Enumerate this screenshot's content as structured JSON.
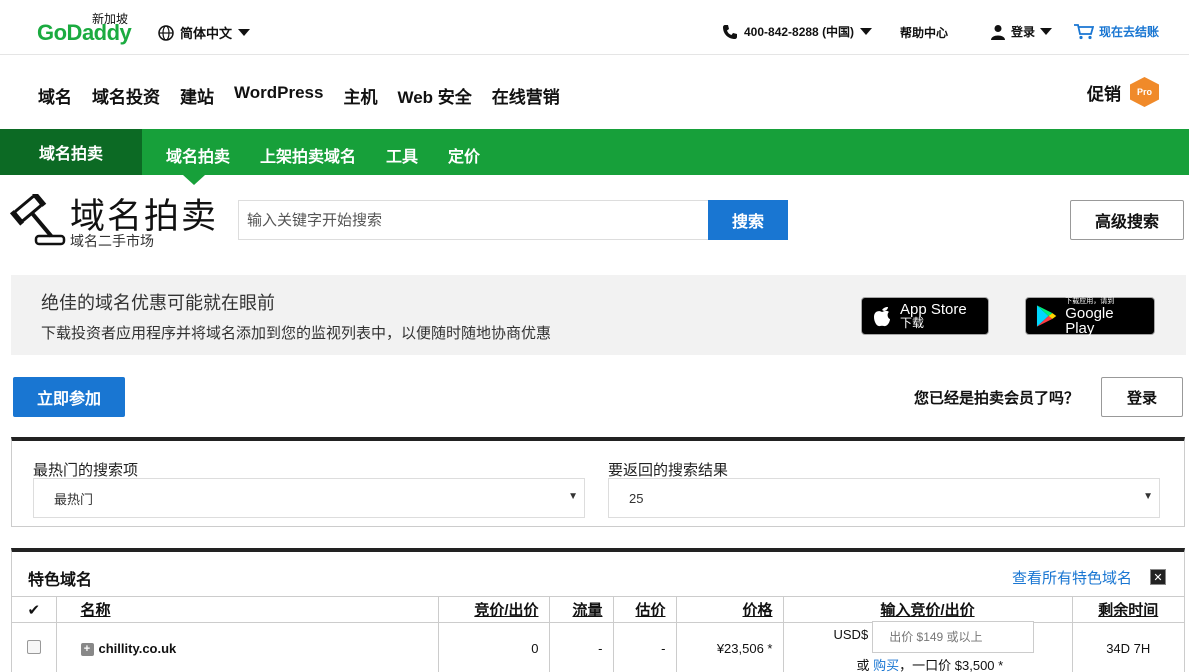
{
  "topbar": {
    "logo_sub": "新加坡",
    "logo_main": "GoDaddy",
    "language": "简体中文",
    "phone": "400-842-8288 (中国)",
    "help": "帮助中心",
    "login": "登录",
    "cart": "现在去结账"
  },
  "mainnav": {
    "items": [
      "域名",
      "域名投资",
      "建站",
      "WordPress",
      "主机",
      "Web 安全",
      "在线营销"
    ],
    "promo": "促销",
    "pro_badge": "Pro"
  },
  "greenbar": {
    "section": "域名拍卖",
    "items": [
      "域名拍卖",
      "上架拍卖域名",
      "工具",
      "定价"
    ]
  },
  "auction": {
    "title": "域名拍卖",
    "subtitle": "域名二手市场",
    "search_placeholder": "输入关键字开始搜索",
    "search_button": "搜索",
    "advanced_button": "高级搜索"
  },
  "banner": {
    "headline": "绝佳的域名优惠可能就在眼前",
    "description": "下载投资者应用程序并将域名添加到您的监视列表中，以便随时随地协商优惠",
    "app_store": {
      "small": "",
      "big": "App Store",
      "sub": "下载"
    },
    "google_play": {
      "small": "下载应用，请到",
      "big": "Google Play"
    }
  },
  "join": {
    "join_button": "立即参加",
    "member_question": "您已经是拍卖会员了吗？",
    "login_button": "登录"
  },
  "filters": {
    "popular_label": "最热门的搜索项",
    "popular_value": "最热门",
    "results_label": "要返回的搜索结果",
    "results_value": "25"
  },
  "featured": {
    "title": "特色域名",
    "view_all": "查看所有特色域名",
    "columns": [
      "名称",
      "竞价/出价",
      "流量",
      "估价",
      "价格",
      "输入竞价/出价",
      "剩余时间"
    ],
    "rows": [
      {
        "name": "chillity.co.uk",
        "bids": "0",
        "traffic": "-",
        "valuation": "-",
        "price": "¥23,506 *",
        "currency": "USD$",
        "bid_placeholder": "出价 $149 或以上",
        "or_text": "或",
        "buy_link": "购买",
        "buy_now_text": "，一口价 $3,500 *",
        "time_left": "34D 7H"
      }
    ]
  }
}
